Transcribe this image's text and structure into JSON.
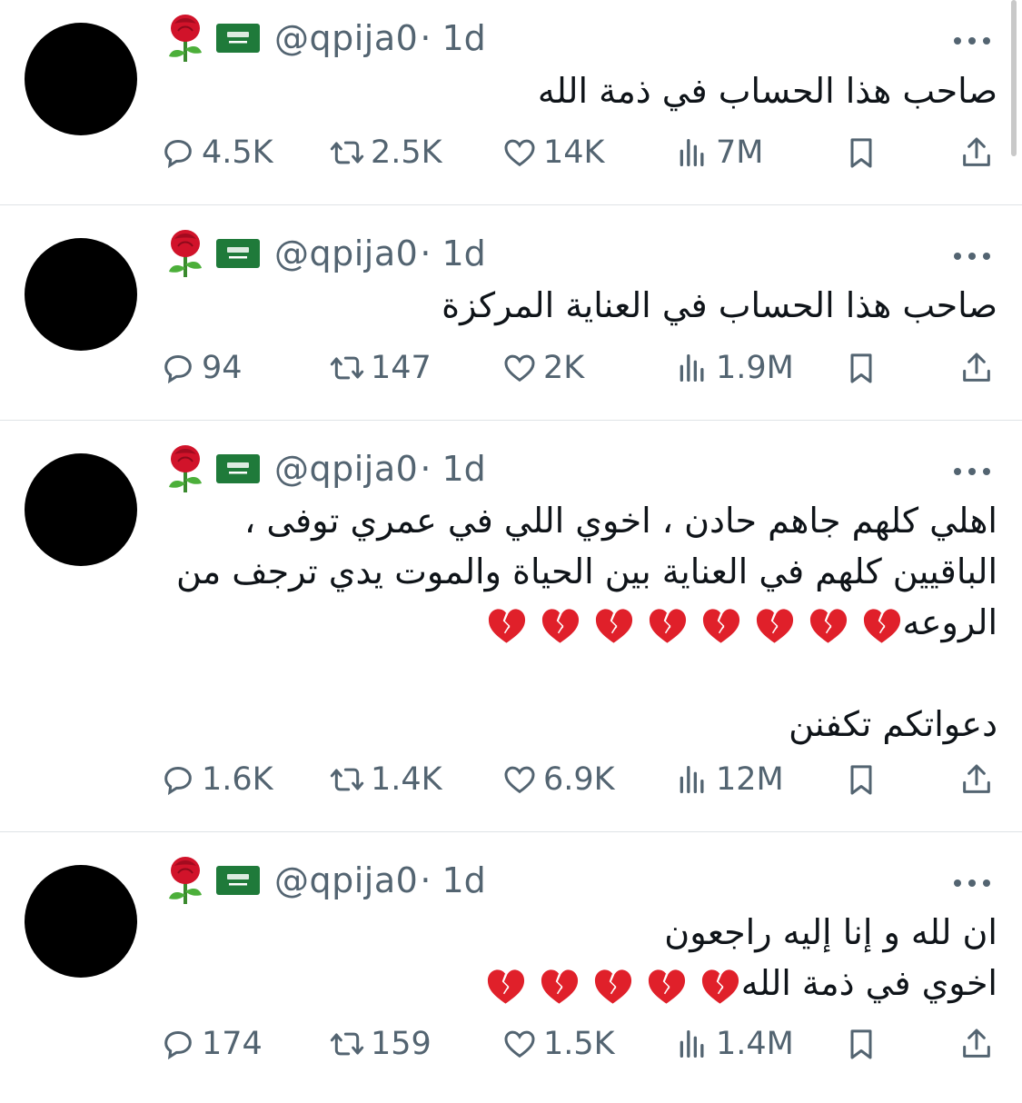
{
  "colors": {
    "text": "#0f1419",
    "muted": "#536471",
    "divider": "#dfe3e6",
    "avatar": "#000000"
  },
  "icons": [
    "rose-emoji",
    "saudi-flag-emoji",
    "more-icon",
    "reply-icon",
    "retweet-icon",
    "like-icon",
    "views-icon",
    "bookmark-icon",
    "share-icon",
    "broken-heart-emoji"
  ],
  "tweets": [
    {
      "handle": "@qpija0",
      "time": "· 1d",
      "lines": [
        "صاحب هذا الحساب في ذمة الله"
      ],
      "broken_hearts": 0,
      "reply": "4.5K",
      "retweet": "2.5K",
      "like": "14K",
      "views": "7M"
    },
    {
      "handle": "@qpija0",
      "time": "· 1d",
      "lines": [
        "صاحب هذا الحساب في العناية المركزة"
      ],
      "broken_hearts": 0,
      "reply": "94",
      "retweet": "147",
      "like": "2K",
      "views": "1.9M"
    },
    {
      "handle": "@qpija0",
      "time": "· 1d",
      "lines": [
        "اهلي كلهم جاهم حادن ، اخوي اللي في عمري توفى ،",
        "الباقيين كلهم في العناية بين الحياة والموت يدي ترجف من",
        "الروعه"
      ],
      "broken_hearts": 8,
      "lines_after": [
        "",
        "دعواتكم تكفنن"
      ],
      "reply": "1.6K",
      "retweet": "1.4K",
      "like": "6.9K",
      "views": "12M"
    },
    {
      "handle": "@qpija0",
      "time": "· 1d",
      "lines": [
        "ان لله و إنا إليه راجعون",
        "اخوي في ذمة الله"
      ],
      "broken_hearts": 5,
      "reply": "174",
      "retweet": "159",
      "like": "1.5K",
      "views": "1.4M"
    }
  ]
}
